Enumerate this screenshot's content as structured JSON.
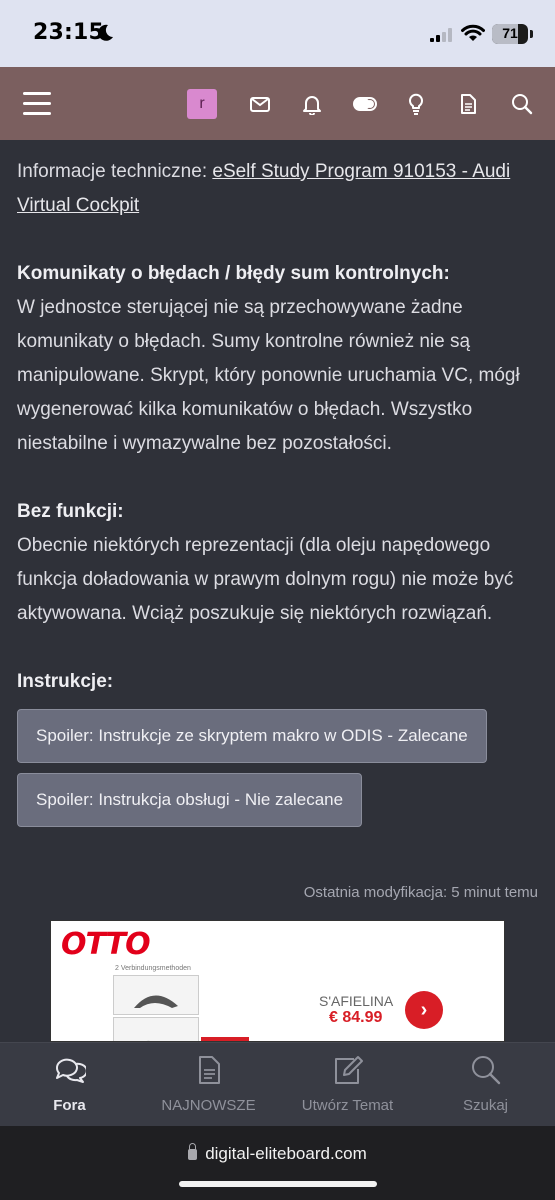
{
  "status_bar": {
    "time": "23:15",
    "battery": "71",
    "battery_fraction": 0.71
  },
  "header": {
    "avatar_letter": "r",
    "icons": [
      "menu-icon",
      "mail-icon",
      "bell-icon",
      "toggle-icon",
      "lightbulb-icon",
      "document-icon",
      "search-icon"
    ]
  },
  "article": {
    "tech_info_label": "Informacje techniczne:",
    "tech_info_link": "eSelf Study Program 910153 - Audi Virtual Cockpit",
    "errors_heading": "Komunikaty o błędach / błędy sum kontrolnych:",
    "errors_text": "W jednostce sterującej nie są przechowywane żadne komunikaty o błędach. Sumy kontrolne również nie są manipulowane. Skrypt, który ponownie uruchamia VC, mógł wygenerować kilka komunikatów o błędach. Wszystko niestabilne i wymazywalne bez pozostałości.",
    "nofunc_heading": "Bez funkcji:",
    "nofunc_text": "Obecnie niektórych reprezentacji (dla oleju napędowego funkcja doładowania w prawym dolnym rogu) nie może być aktywowana. Wciąż poszukuje się niektórych rozwiązań.",
    "instructions_heading": "Instrukcje:",
    "spoiler_1": "Spoiler: Instrukcje ze skryptem makro w ODIS - Zalecane",
    "spoiler_2": "Spoiler: Instrukcja obsługi - Nie zalecane",
    "last_modified": "Ostatnia modyfikacja: 5 minut temu"
  },
  "ad": {
    "logo": "OTTO",
    "subtitle": "2 Verbindungsmethoden",
    "brand": "S'AFIELINA",
    "price": "€ 84.99",
    "button_glyph": "›"
  },
  "bottom_nav": {
    "items": [
      {
        "label": "Fora",
        "icon": "chat-bubbles-icon"
      },
      {
        "label": "NAJNOWSZE",
        "icon": "document-icon"
      },
      {
        "label": "Utwórz Temat",
        "icon": "edit-icon"
      },
      {
        "label": "Szukaj",
        "icon": "search-icon"
      }
    ]
  },
  "browser": {
    "url": "digital-eliteboard.com"
  },
  "colors": {
    "background": "#2f3139",
    "appbar": "#7b5f5f",
    "status_bar": "#dfe3f1",
    "spoiler": "#6a6d7d",
    "accent_red": "#d81e26"
  }
}
